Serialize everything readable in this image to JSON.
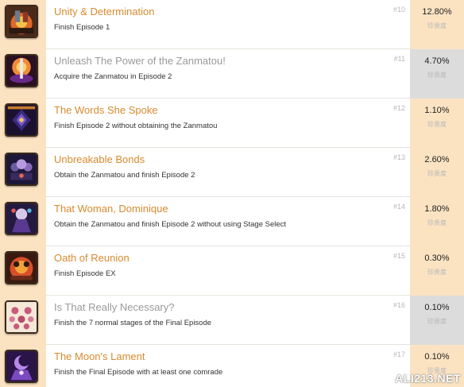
{
  "achievements": [
    {
      "title": "Unity & Determination",
      "desc": "Finish Episode 1",
      "num": "#10",
      "pct": "12.80%",
      "rarity": "珍贵度",
      "dim": false,
      "grey": false,
      "icon": "fire-warriors-icon"
    },
    {
      "title": "Unleash The Power of the Zanmatou!",
      "desc": "Acquire the Zanmatou in Episode 2",
      "num": "#11",
      "pct": "4.70%",
      "rarity": "珍贵度",
      "dim": true,
      "grey": true,
      "icon": "sword-power-icon"
    },
    {
      "title": "The Words She Spoke",
      "desc": "Finish Episode 2 without obtaining the Zanmatou",
      "num": "#12",
      "pct": "1.10%",
      "rarity": "珍贵度",
      "dim": false,
      "grey": false,
      "icon": "dark-crystal-icon"
    },
    {
      "title": "Unbreakable Bonds",
      "desc": "Obtain the Zanmatou and finish Episode 2",
      "num": "#13",
      "pct": "2.60%",
      "rarity": "珍贵度",
      "dim": false,
      "grey": false,
      "icon": "group-bond-icon"
    },
    {
      "title": "That Woman, Dominique",
      "desc": "Obtain the Zanmatou and finish Episode 2 without using Stage Select",
      "num": "#14",
      "pct": "1.80%",
      "rarity": "珍贵度",
      "dim": false,
      "grey": false,
      "icon": "dominique-icon"
    },
    {
      "title": "Oath of Reunion",
      "desc": "Finish Episode EX",
      "num": "#15",
      "pct": "0.30%",
      "rarity": "珍贵度",
      "dim": false,
      "grey": false,
      "icon": "reunion-fire-icon"
    },
    {
      "title": "Is That Really Necessary?",
      "desc": "Finish the 7 normal stages of the Final Episode",
      "num": "#16",
      "pct": "0.10%",
      "rarity": "珍贵度",
      "dim": true,
      "grey": true,
      "icon": "stage-buttons-icon"
    },
    {
      "title": "The Moon's Lament",
      "desc": "Finish the Final Episode with at least one comrade",
      "num": "#17",
      "pct": "0.10%",
      "rarity": "珍贵度",
      "dim": false,
      "grey": false,
      "icon": "purple-moon-icon"
    }
  ],
  "watermark": "ALI213.NET"
}
